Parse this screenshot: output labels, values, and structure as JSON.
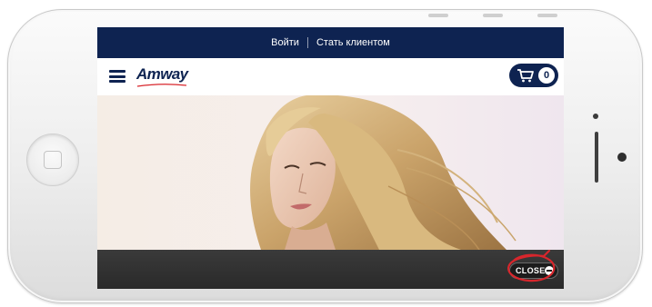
{
  "topbar": {
    "login_label": "Войти",
    "become_client_label": "Стать клиентом"
  },
  "header": {
    "logo_text": "Amway",
    "cart_count": "0"
  },
  "player": {
    "close_label": "CLOSE"
  },
  "colors": {
    "brand_navy": "#0e2351",
    "highlight_red": "#d8262c"
  },
  "icons": [
    "hamburger-menu-icon",
    "cart-icon",
    "close-minus-icon",
    "home-button-icon"
  ]
}
